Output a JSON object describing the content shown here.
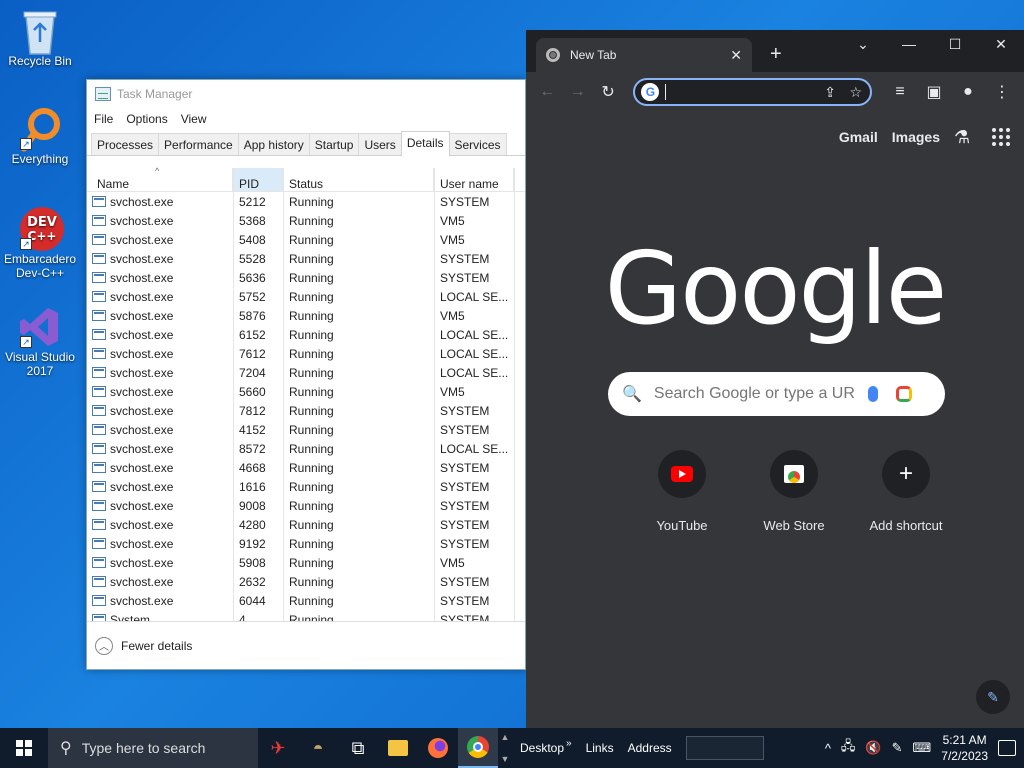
{
  "desktop": {
    "icons": [
      {
        "label": "Recycle Bin"
      },
      {
        "label": "Everything"
      },
      {
        "label": "Embarcadero Dev-C++"
      },
      {
        "label": "Visual Studio 2017"
      }
    ],
    "devcpp_badge": "DEV C++"
  },
  "task_manager": {
    "title": "Task Manager",
    "menu": [
      "File",
      "Options",
      "View"
    ],
    "tabs": [
      "Processes",
      "Performance",
      "App history",
      "Startup",
      "Users",
      "Details",
      "Services"
    ],
    "active_tab": "Details",
    "columns": [
      "Name",
      "PID",
      "Status",
      "User name"
    ],
    "rows": [
      [
        "svchost.exe",
        "5212",
        "Running",
        "SYSTEM"
      ],
      [
        "svchost.exe",
        "5368",
        "Running",
        "VM5"
      ],
      [
        "svchost.exe",
        "5408",
        "Running",
        "VM5"
      ],
      [
        "svchost.exe",
        "5528",
        "Running",
        "SYSTEM"
      ],
      [
        "svchost.exe",
        "5636",
        "Running",
        "SYSTEM"
      ],
      [
        "svchost.exe",
        "5752",
        "Running",
        "LOCAL SE..."
      ],
      [
        "svchost.exe",
        "5876",
        "Running",
        "VM5"
      ],
      [
        "svchost.exe",
        "6152",
        "Running",
        "LOCAL SE..."
      ],
      [
        "svchost.exe",
        "7612",
        "Running",
        "LOCAL SE..."
      ],
      [
        "svchost.exe",
        "7204",
        "Running",
        "LOCAL SE..."
      ],
      [
        "svchost.exe",
        "5660",
        "Running",
        "VM5"
      ],
      [
        "svchost.exe",
        "7812",
        "Running",
        "SYSTEM"
      ],
      [
        "svchost.exe",
        "4152",
        "Running",
        "SYSTEM"
      ],
      [
        "svchost.exe",
        "8572",
        "Running",
        "LOCAL SE..."
      ],
      [
        "svchost.exe",
        "4668",
        "Running",
        "SYSTEM"
      ],
      [
        "svchost.exe",
        "1616",
        "Running",
        "SYSTEM"
      ],
      [
        "svchost.exe",
        "9008",
        "Running",
        "SYSTEM"
      ],
      [
        "svchost.exe",
        "4280",
        "Running",
        "SYSTEM"
      ],
      [
        "svchost.exe",
        "9192",
        "Running",
        "SYSTEM"
      ],
      [
        "svchost.exe",
        "5908",
        "Running",
        "VM5"
      ],
      [
        "svchost.exe",
        "2632",
        "Running",
        "SYSTEM"
      ],
      [
        "svchost.exe",
        "6044",
        "Running",
        "SYSTEM"
      ],
      [
        "System",
        "4",
        "Running",
        "SYSTEM"
      ]
    ],
    "footer": "Fewer details"
  },
  "chrome": {
    "tab_title": "New Tab",
    "links": [
      "Gmail",
      "Images"
    ],
    "logo": "Google",
    "search_placeholder": "Search Google or type a URL",
    "shortcuts": [
      "YouTube",
      "Web Store",
      "Add shortcut"
    ],
    "icons": {
      "back": "←",
      "forward": "→",
      "reload": "↻",
      "share": "⇪",
      "star": "☆",
      "media": "≡",
      "sidepanel": "▣",
      "profile": "●",
      "menu": "⋮",
      "close": "✕",
      "plus": "+",
      "minimize": "—",
      "maximize": "☐",
      "caret": "⌄",
      "flask": "⚗",
      "search": "🔍",
      "pencil": "✎"
    }
  },
  "taskbar": {
    "search_placeholder": "Type here to search",
    "toolbars": [
      "Desktop",
      "Links",
      "Address"
    ],
    "time": "5:21 AM",
    "date": "7/2/2023",
    "colors": {
      "bg": "#101c2b",
      "accent": "#7ab8f0"
    }
  }
}
